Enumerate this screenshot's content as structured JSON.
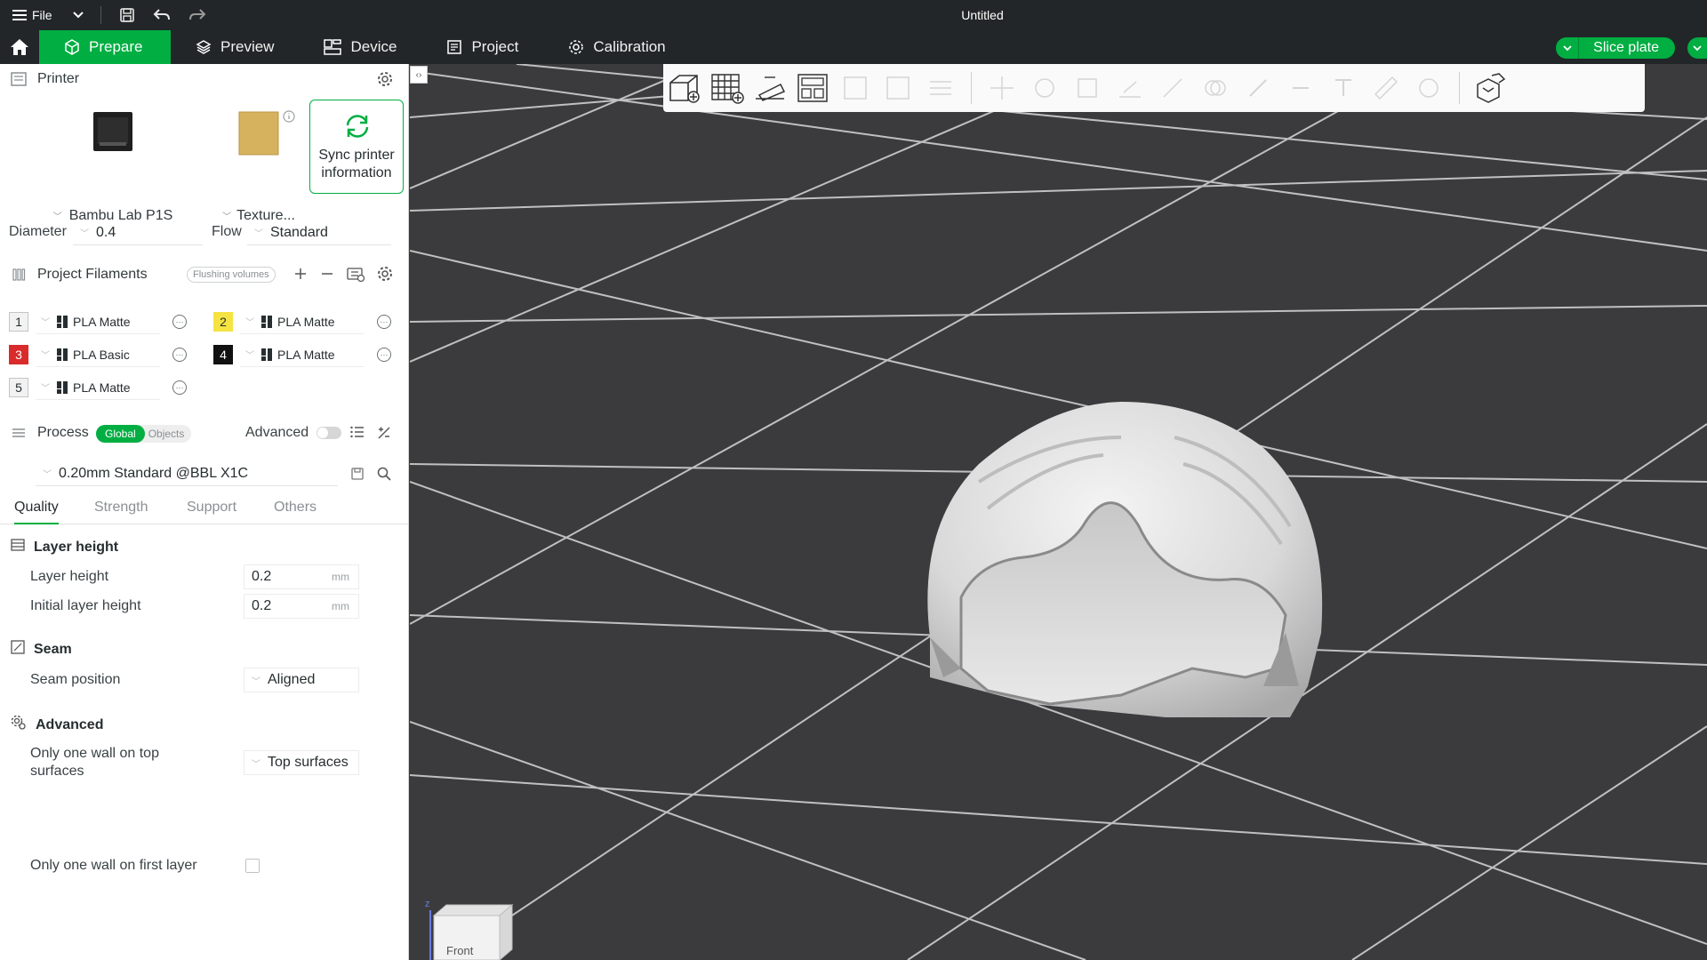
{
  "titlebar": {
    "file_label": "File",
    "document_title": "Untitled"
  },
  "nav": {
    "tabs": [
      {
        "label": "Prepare",
        "icon": "cube-icon",
        "active": true
      },
      {
        "label": "Preview",
        "icon": "layers-icon",
        "active": false
      },
      {
        "label": "Device",
        "icon": "device-icon",
        "active": false
      },
      {
        "label": "Project",
        "icon": "project-icon",
        "active": false
      },
      {
        "label": "Calibration",
        "icon": "calibration-icon",
        "active": false
      }
    ],
    "slice_label": "Slice plate",
    "accent_color": "#00ae42"
  },
  "printer": {
    "section_title": "Printer",
    "printer_name": "Bambu Lab P1S",
    "plate_name": "Texture...",
    "sync_label_line1": "Sync printer",
    "sync_label_line2": "information",
    "diameter_label": "Diameter",
    "diameter_value": "0.4",
    "flow_label": "Flow",
    "flow_value": "Standard"
  },
  "filaments": {
    "section_title": "Project Filaments",
    "flushing_label": "Flushing volumes",
    "items": [
      {
        "num": "1",
        "name": "PLA Matte",
        "color": "#f2f2f2",
        "text_color": "#333333"
      },
      {
        "num": "2",
        "name": "PLA Matte",
        "color": "#f5e342",
        "text_color": "#333333"
      },
      {
        "num": "3",
        "name": "PLA Basic",
        "color": "#d92b2b",
        "text_color": "#ffffff"
      },
      {
        "num": "4",
        "name": "PLA Matte",
        "color": "#111111",
        "text_color": "#ffffff"
      },
      {
        "num": "5",
        "name": "PLA Matte",
        "color": "#f2f2f2",
        "text_color": "#333333"
      }
    ]
  },
  "process": {
    "section_title": "Process",
    "global_label": "Global",
    "objects_label": "Objects",
    "advanced_label": "Advanced",
    "preset": "0.20mm Standard @BBL X1C",
    "tabs": [
      "Quality",
      "Strength",
      "Support",
      "Others"
    ],
    "layer_height_group": "Layer height",
    "layer_height_label": "Layer height",
    "layer_height_value": "0.2",
    "initial_layer_height_label": "Initial layer height",
    "initial_layer_height_value": "0.2",
    "unit": "mm",
    "seam_group": "Seam",
    "seam_position_label": "Seam position",
    "seam_position_value": "Aligned",
    "advanced_group": "Advanced",
    "one_wall_top_label_line1": "Only one wall on top",
    "one_wall_top_label_line2": "surfaces",
    "one_wall_top_value": "Top surfaces",
    "one_wall_first_label": "Only one wall on first layer",
    "one_wall_first_checked": false
  },
  "viewport": {
    "view_cube_label": "Front",
    "axis_label": "z"
  }
}
